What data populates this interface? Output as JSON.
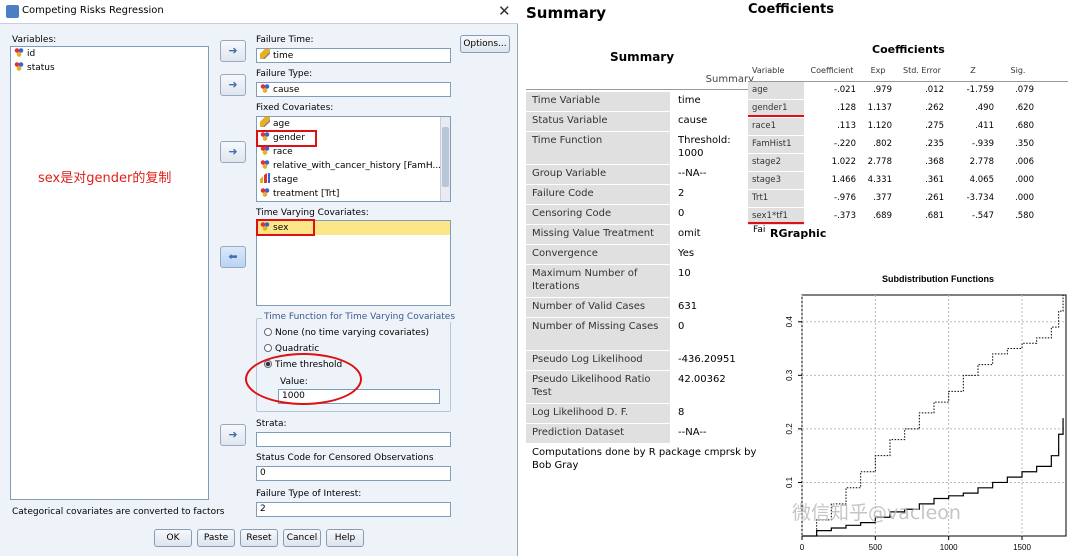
{
  "dialog": {
    "title": "Competing Risks Regression",
    "close_glyph": "✕",
    "variables_label": "Variables:",
    "variables": [
      {
        "name": "id",
        "icon": "nominal-icon"
      },
      {
        "name": "status",
        "icon": "nominal-icon"
      }
    ],
    "annotation": "sex是对gender的复制",
    "failure_time_label": "Failure Time:",
    "failure_time_value": "time",
    "failure_type_label": "Failure Type:",
    "failure_type_value": "cause",
    "fixed_covariates_label": "Fixed Covariates:",
    "fixed_covariates": [
      {
        "name": "age",
        "icon": "pencil-icon"
      },
      {
        "name": "gender",
        "icon": "nominal-icon"
      },
      {
        "name": "race",
        "icon": "nominal-icon"
      },
      {
        "name": "relative_with_cancer_history [FamH...",
        "icon": "nominal-icon"
      },
      {
        "name": "stage",
        "icon": "scale-icon"
      },
      {
        "name": "treatment [Trt]",
        "icon": "nominal-icon"
      }
    ],
    "time_varying_label": "Time Varying Covariates:",
    "time_varying": [
      {
        "name": "sex",
        "icon": "nominal-icon"
      }
    ],
    "time_function_group": "Time Function for Time Varying Covariates",
    "radio_none": "None (no time varying covariates)",
    "radio_quadratic": "Quadratic",
    "radio_threshold": "Time threshold",
    "value_label": "Value:",
    "value": "1000",
    "strata_label": "Strata:",
    "strata_value": "",
    "status_code_label": "Status Code for Censored Observations",
    "status_code_value": "0",
    "failure_interest_label": "Failure Type of Interest:",
    "failure_interest_value": "2",
    "footnote": "Categorical covariates are converted to factors",
    "options_button": "Options...",
    "buttons": [
      "OK",
      "Paste",
      "Reset",
      "Cancel",
      "Help"
    ]
  },
  "summary": {
    "heading": "Summary",
    "table_title": "Summary",
    "column_header": "Summary",
    "rows": [
      {
        "label": "Time Variable",
        "value": "time"
      },
      {
        "label": "Status Variable",
        "value": "cause"
      },
      {
        "label": "Time Function",
        "value": "Threshold: 1000"
      },
      {
        "label": "Group Variable",
        "value": "--NA--"
      },
      {
        "label": "Failure Code",
        "value": "2"
      },
      {
        "label": "Censoring Code",
        "value": "0"
      },
      {
        "label": "Missing Value Treatment",
        "value": "omit"
      },
      {
        "label": "Convergence",
        "value": "Yes"
      },
      {
        "label": "Maximum Number of Iterations",
        "value": "10"
      },
      {
        "label": "Number of Valid Cases",
        "value": "631"
      },
      {
        "label": "Number of Missing Cases",
        "value": "0"
      },
      {
        "label": "Pseudo Log Likelihood",
        "value": "-436.20951"
      },
      {
        "label": "Pseudo Likelihood Ratio Test",
        "value": "42.00362"
      },
      {
        "label": "Log Likelihood D. F.",
        "value": "8"
      },
      {
        "label": "Prediction Dataset",
        "value": "--NA--"
      }
    ],
    "footnote": "Computations done by R package cmprsk by Bob Gray"
  },
  "coefficients": {
    "heading": "Coefficients",
    "table_title": "Coefficients",
    "headers": [
      "Variable",
      "Coefficient",
      "Exp",
      "Std. Error",
      "Z",
      "Sig."
    ],
    "rows": [
      [
        "age",
        "-.021",
        ".979",
        ".012",
        "-1.759",
        ".079"
      ],
      [
        "gender1",
        ".128",
        "1.137",
        ".262",
        ".490",
        ".620"
      ],
      [
        "race1",
        ".113",
        "1.120",
        ".275",
        ".411",
        ".680"
      ],
      [
        "FamHist1",
        "-.220",
        ".802",
        ".235",
        "-.939",
        ".350"
      ],
      [
        "stage2",
        "1.022",
        "2.778",
        ".368",
        "2.778",
        ".006"
      ],
      [
        "stage3",
        "1.466",
        "4.331",
        ".361",
        "4.065",
        ".000"
      ],
      [
        "Trt1",
        "-.976",
        ".377",
        ".261",
        "-3.734",
        ".000"
      ],
      [
        "sex1*tf1",
        "-.373",
        ".689",
        ".681",
        "-.547",
        ".580"
      ]
    ],
    "trailing": "Fai"
  },
  "rgraphic": {
    "heading": "RGraphic",
    "watermark": "微信知乎@vacleon",
    "chart_data": {
      "type": "line",
      "title": "Subdistribution Functions",
      "xlabel": "",
      "ylabel": "",
      "xlim": [
        0,
        1800
      ],
      "ylim": [
        0,
        0.45
      ],
      "x_ticks": [
        "0",
        "500",
        "1000",
        "1500"
      ],
      "y_ticks": [
        "0.1",
        "0.2",
        "0.3",
        "0.4"
      ],
      "grid": true,
      "series": [
        {
          "style": "dotted",
          "x": [
            0,
            100,
            200,
            300,
            400,
            500,
            600,
            700,
            800,
            900,
            1000,
            1100,
            1200,
            1300,
            1400,
            1500,
            1600,
            1700,
            1750,
            1780
          ],
          "y": [
            0.0,
            0.03,
            0.06,
            0.09,
            0.12,
            0.15,
            0.18,
            0.2,
            0.23,
            0.25,
            0.27,
            0.3,
            0.32,
            0.34,
            0.35,
            0.36,
            0.37,
            0.39,
            0.42,
            0.45
          ]
        },
        {
          "style": "solid",
          "x": [
            0,
            100,
            200,
            300,
            400,
            500,
            600,
            700,
            800,
            900,
            1000,
            1100,
            1200,
            1300,
            1400,
            1500,
            1600,
            1700,
            1750,
            1780
          ],
          "y": [
            0.0,
            0.01,
            0.015,
            0.02,
            0.025,
            0.035,
            0.045,
            0.05,
            0.06,
            0.07,
            0.075,
            0.08,
            0.09,
            0.1,
            0.11,
            0.12,
            0.13,
            0.15,
            0.19,
            0.22
          ]
        }
      ]
    }
  },
  "colors": {
    "dialog_bg": "#eef3fa",
    "highlight": "#fde68a",
    "red_annot": "#d11",
    "table_label_bg": "#e0e0e0"
  }
}
